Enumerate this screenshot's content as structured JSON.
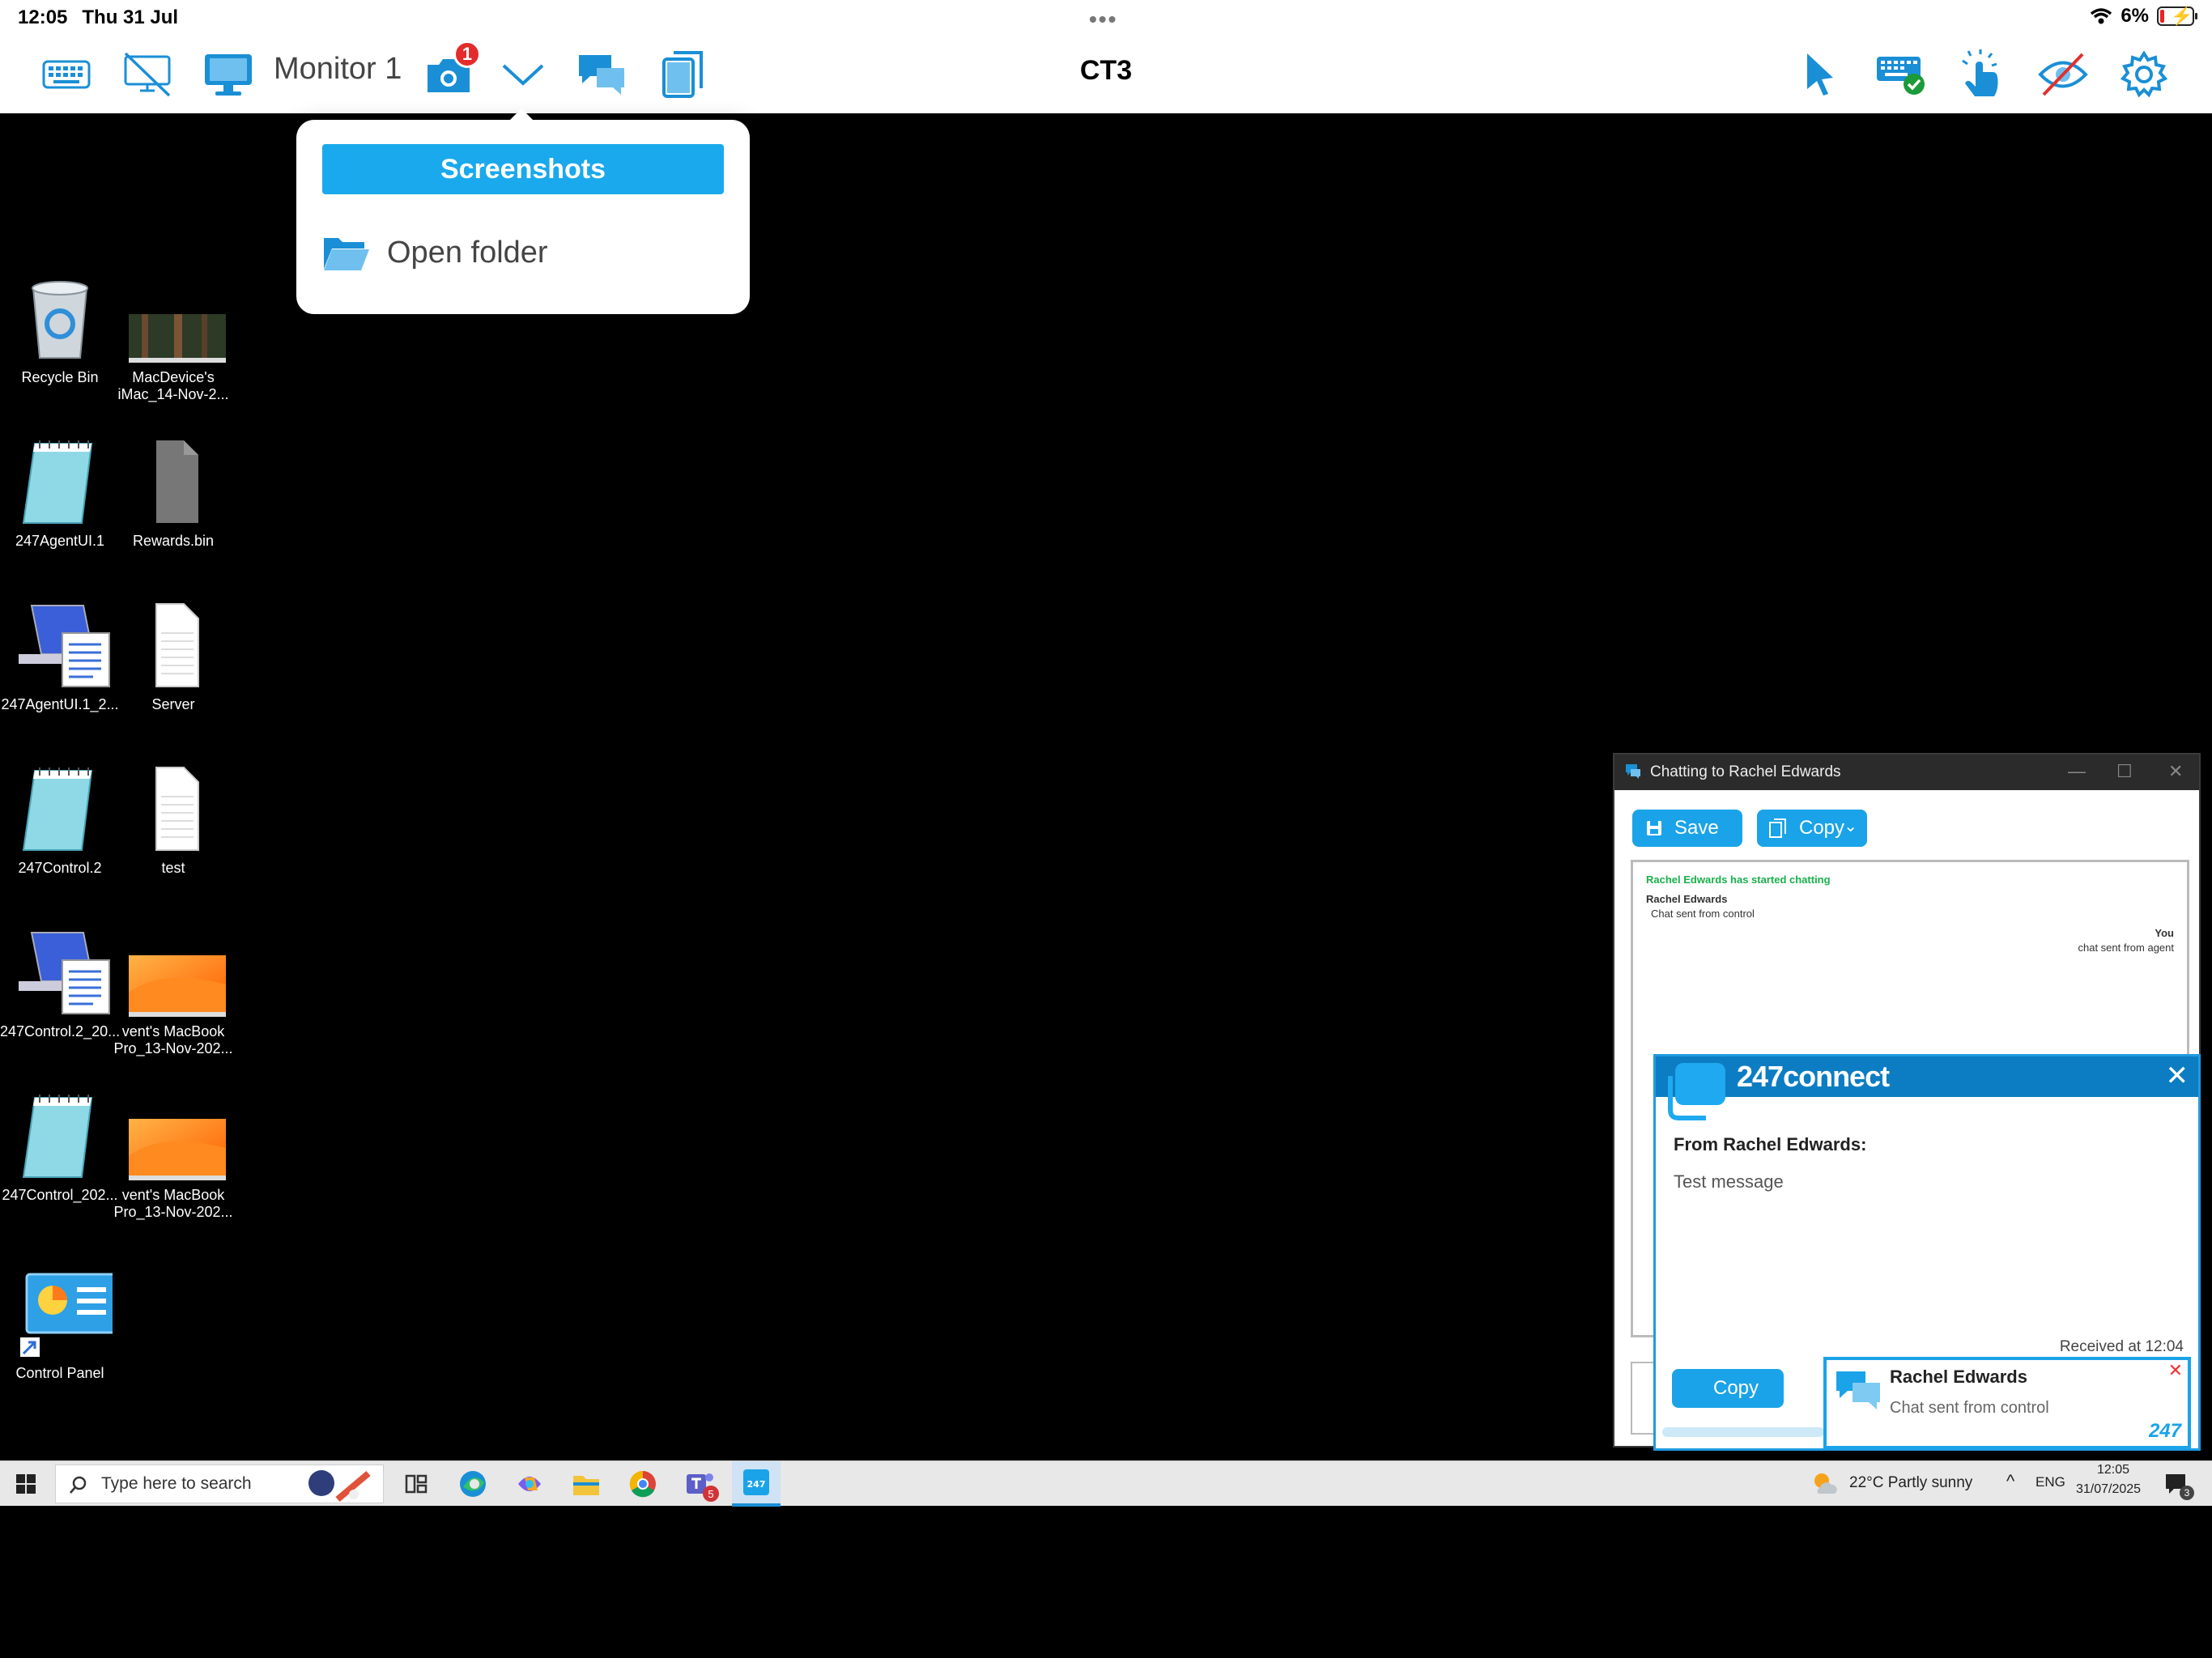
{
  "status_bar": {
    "time": "12:05",
    "date": "Thu 31 Jul",
    "battery": "6%"
  },
  "toolbar": {
    "monitor_label": "Monitor 1",
    "screenshot_badge": "1",
    "title": "CT3",
    "colors": {
      "accent": "#1a8fd6",
      "badge": "#e42b2b"
    }
  },
  "screenshot_menu": {
    "header": "Screenshots",
    "open_folder": "Open folder"
  },
  "desktop_icons": [
    {
      "label_1": "Recycle Bin",
      "label_2": ""
    },
    {
      "label_1": "MacDevice's",
      "label_2": "iMac_14-Nov-2..."
    },
    {
      "label_1": "247AgentUI.1",
      "label_2": ""
    },
    {
      "label_1": "Rewards.bin",
      "label_2": ""
    },
    {
      "label_1": "247AgentUI.1_2...",
      "label_2": ""
    },
    {
      "label_1": "Server",
      "label_2": ""
    },
    {
      "label_1": "247Control.2",
      "label_2": ""
    },
    {
      "label_1": "test",
      "label_2": ""
    },
    {
      "label_1": "247Control.2_20...",
      "label_2": ""
    },
    {
      "label_1": "vent's MacBook",
      "label_2": "Pro_13-Nov-202..."
    },
    {
      "label_1": "247Control_202...",
      "label_2": ""
    },
    {
      "label_1": "vent's MacBook",
      "label_2": "Pro_13-Nov-202..."
    },
    {
      "label_1": "Control Panel",
      "label_2": ""
    }
  ],
  "chat_window": {
    "title": "Chatting to Rachel Edwards",
    "save_label": "Save",
    "copy_label": "Copy",
    "log": {
      "started": "Rachel Edwards has started chatting",
      "sender_1": "Rachel Edwards",
      "message_1": "Chat sent from control",
      "sender_2": "You",
      "message_2": "chat sent from agent"
    }
  },
  "connect_popup": {
    "brand": "247connect",
    "from": "From Rachel Edwards:",
    "message": "Test message",
    "received": "Received at 12:04",
    "copy_label": "Copy"
  },
  "toast": {
    "name": "Rachel Edwards",
    "message": "Chat sent from control",
    "brand": "247"
  },
  "taskbar": {
    "search_placeholder": "Type here to search",
    "teams_badge": "5",
    "weather": "22°C  Partly sunny",
    "language": "ENG",
    "time": "12:05",
    "date": "31/07/2025",
    "notification_count": "3"
  }
}
